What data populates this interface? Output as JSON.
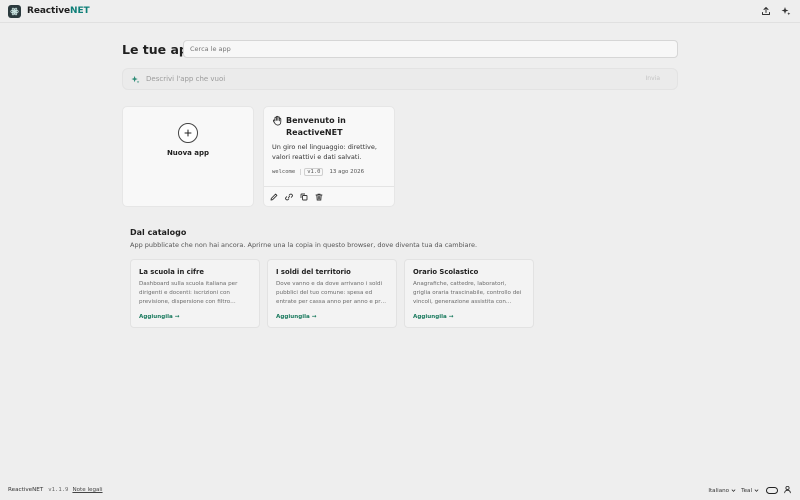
{
  "app": {
    "name_main": "Reactive",
    "name_accent": "NET",
    "accent_color": "#0f7f78",
    "logo_icon": "atom-icon"
  },
  "header": {
    "actions": [
      {
        "icon": "upload-icon"
      },
      {
        "icon": "sparkles-icon"
      }
    ]
  },
  "main": {
    "title": "Le tue app",
    "search_placeholder": "Cerca le app",
    "prompt": {
      "icon": "sparkles-icon",
      "placeholder": "Descrivi l'app che vuoi",
      "button_label": "Invia"
    },
    "new_app_label": "Nuova app",
    "apps": [
      {
        "icon": "hand-wave-icon",
        "title": "Benvenuto in ReactiveNET",
        "description": "Un giro nel linguaggio: direttive, valori reattivi e dati salvati.",
        "slug": "welcome",
        "version": "v1.0",
        "date": "13 ago 2026",
        "actions": [
          "edit-icon",
          "link-icon",
          "copy-icon",
          "trash-icon"
        ]
      }
    ]
  },
  "catalog": {
    "title": "Dal catalogo",
    "subtitle": "App pubblicate che non hai ancora. Aprirne una la copia in questo browser, dove diventa tua da cambiare.",
    "items": [
      {
        "name": "La scuola in cifre",
        "description": "Dashboard sulla scuola italiana per dirigenti e docenti: iscrizioni con previsione, dispersione con filtro…",
        "add_label": "Aggiungila →"
      },
      {
        "name": "I soldi del territorio",
        "description": "Dove vanno e da dove arrivano i soldi pubblici del tuo comune: spesa ed entrate per cassa anno per anno e pr…",
        "add_label": "Aggiungila →"
      },
      {
        "name": "Orario Scolastico",
        "description": "Anagrafiche, cattedre, laboratori, griglia oraria trascinabile, controllo dei vincoli, generazione assistita con…",
        "add_label": "Aggiungila →"
      }
    ]
  },
  "footer": {
    "brand": "ReactiveNET",
    "version": "v1.1.9",
    "legal_link": "Note legali",
    "language": "Italiano",
    "theme": "Teal",
    "theme_toggle_icon": "toggle-icon",
    "user_icon": "user-icon"
  }
}
